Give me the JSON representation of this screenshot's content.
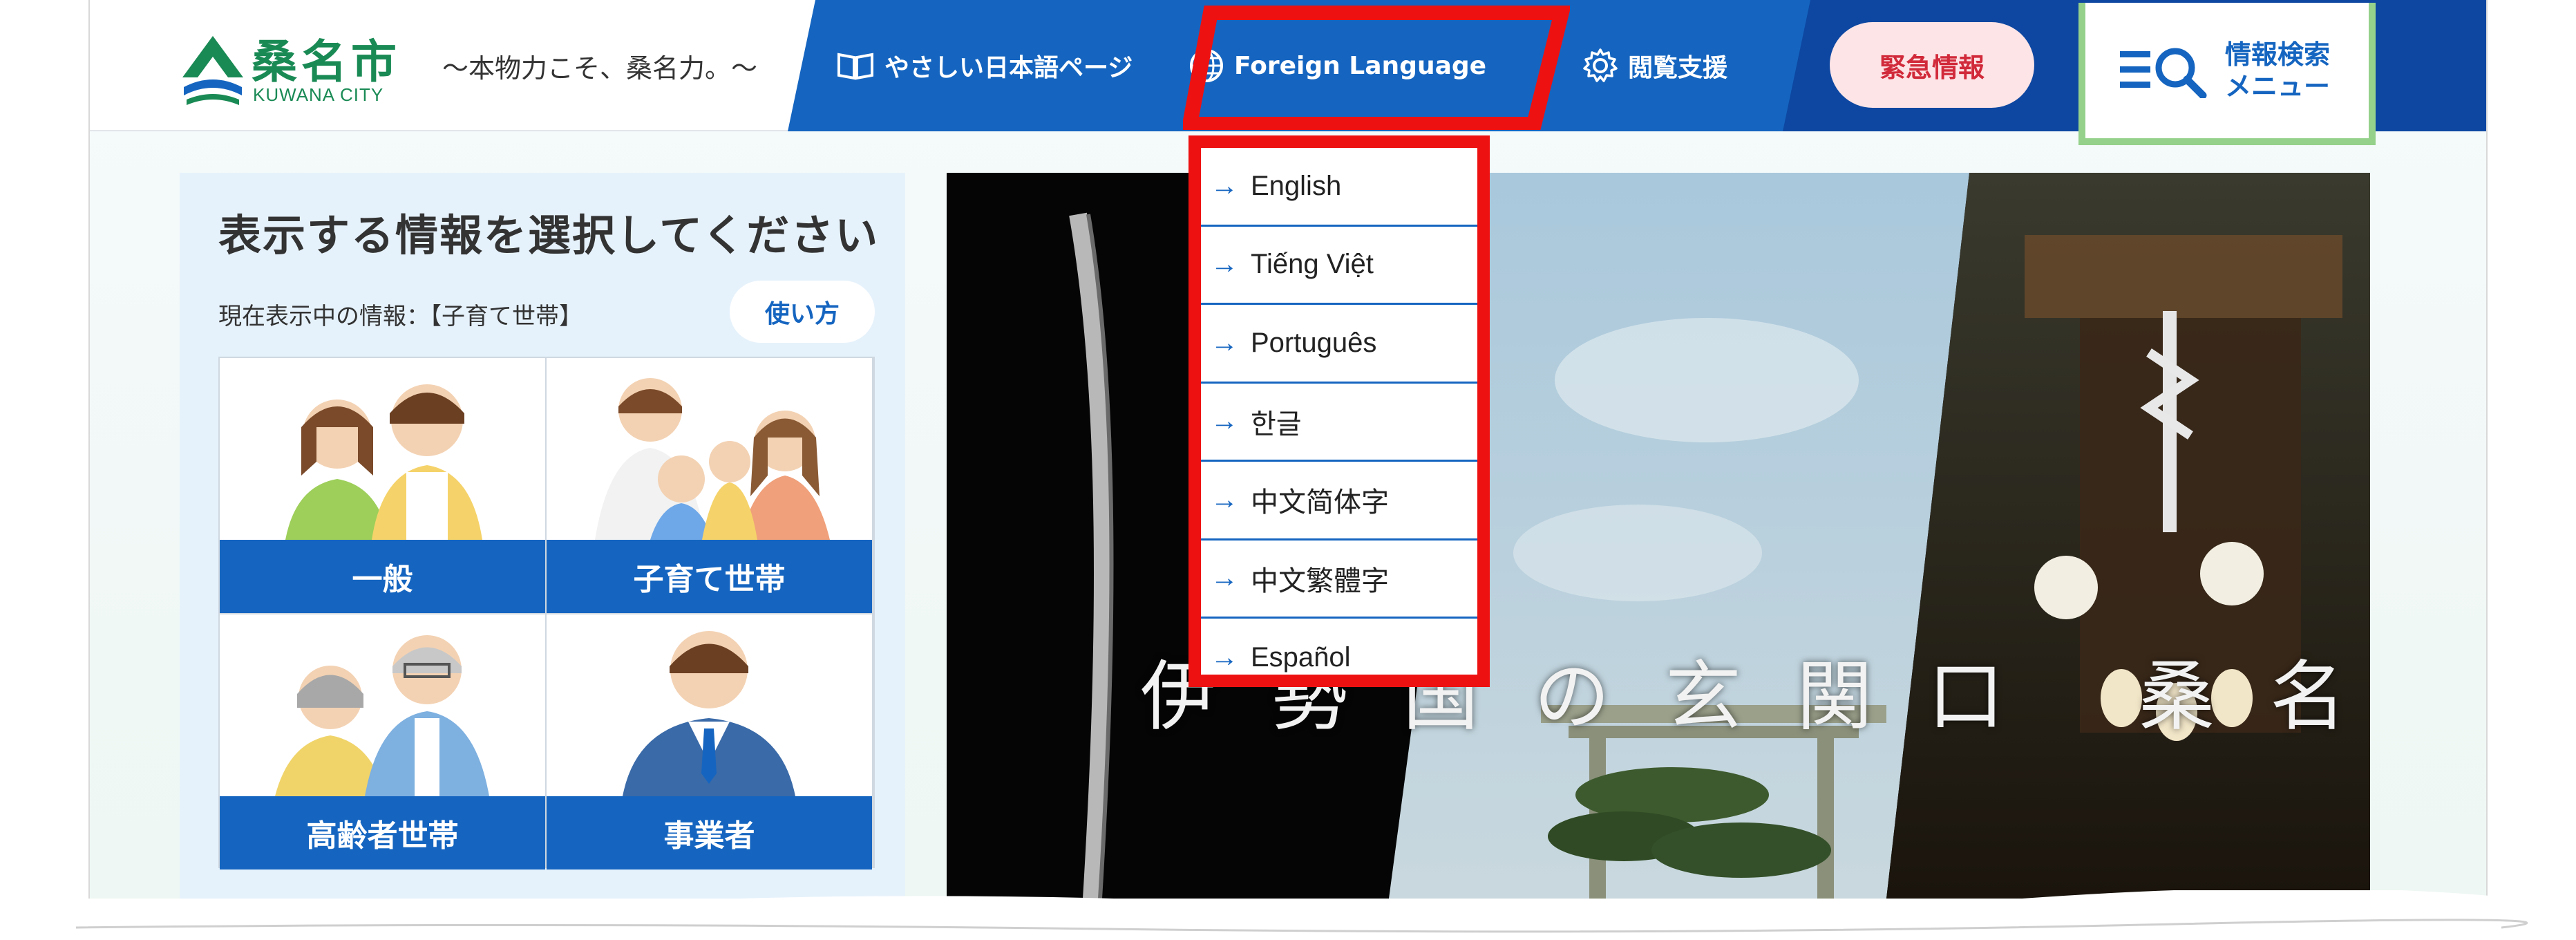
{
  "header": {
    "logo_name": "桑名市",
    "logo_sub": "KUWANA CITY",
    "tagline": "〜本物力こそ、桑名力。〜",
    "nav": {
      "easy_japanese": "やさしい日本語ページ",
      "foreign_language": "Foreign Language",
      "accessibility": "閲覧支援",
      "emergency": "緊急情報",
      "search_menu_line1": "情報検索",
      "search_menu_line2": "メニュー"
    },
    "icons": {
      "easy_japanese": "book-icon",
      "foreign_language": "globe-icon",
      "accessibility": "gear-icon",
      "search_menu": "search-list-icon"
    }
  },
  "language_menu": {
    "items": [
      {
        "label": "English"
      },
      {
        "label": "Tiếng Việt"
      },
      {
        "label": "Português"
      },
      {
        "label": "한글"
      },
      {
        "label": "中文简体字"
      },
      {
        "label": "中文繁體字"
      },
      {
        "label": "Español"
      }
    ]
  },
  "panel": {
    "title": "表示する情報を選択してください",
    "current_info": "現在表示中の情報：【子育て世帯】",
    "howto_button": "使い方",
    "cards": [
      {
        "label": "一般"
      },
      {
        "label": "子育て世帯"
      },
      {
        "label": "高齢者世帯"
      },
      {
        "label": "事業者"
      }
    ]
  },
  "hero": {
    "caption": "伊勢国の玄関口 桑名"
  },
  "colors": {
    "primary_blue": "#1565c0",
    "dark_blue": "#0d47a1",
    "highlight_red": "#ee1111",
    "emergency_bg": "#fde4e6",
    "emergency_text": "#d12a3a",
    "logo_green": "#1a8a55",
    "search_border": "#95d18b"
  }
}
